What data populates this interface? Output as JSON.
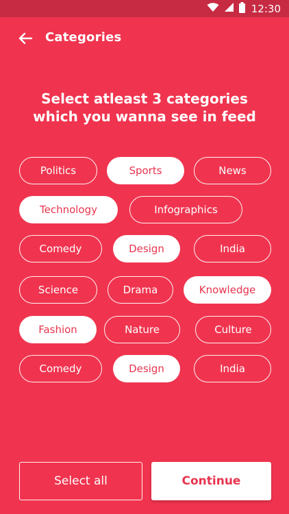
{
  "status_bar": {
    "time": "12:30",
    "icons": [
      "wifi-icon",
      "signal-icon",
      "battery-icon"
    ]
  },
  "app_bar": {
    "title": "Categories",
    "back_icon": "arrow-left-icon"
  },
  "heading": {
    "line1": "Select atleast 3 categories",
    "line2": "which you wanna see in feed"
  },
  "categories": [
    {
      "label": "Politics",
      "selected": false
    },
    {
      "label": "Sports",
      "selected": true
    },
    {
      "label": "News",
      "selected": false
    },
    {
      "label": "Technology",
      "selected": true
    },
    {
      "label": "Infographics",
      "selected": false
    },
    {
      "label": "Comedy",
      "selected": false
    },
    {
      "label": "Design",
      "selected": true
    },
    {
      "label": "India",
      "selected": false
    },
    {
      "label": "Science",
      "selected": false
    },
    {
      "label": "Drama",
      "selected": false
    },
    {
      "label": "Knowledge",
      "selected": true
    },
    {
      "label": "Fashion",
      "selected": true
    },
    {
      "label": "Nature",
      "selected": false
    },
    {
      "label": "Culture",
      "selected": false
    },
    {
      "label": "Comedy",
      "selected": false
    },
    {
      "label": "Design",
      "selected": true
    },
    {
      "label": "India",
      "selected": false
    }
  ],
  "buttons": {
    "select_all": "Select all",
    "continue": "Continue"
  },
  "colors": {
    "background": "#f0344f",
    "status_bar": "#c72b43",
    "accent_text": "#e8344e",
    "chip_selected_bg": "#ffffff"
  }
}
